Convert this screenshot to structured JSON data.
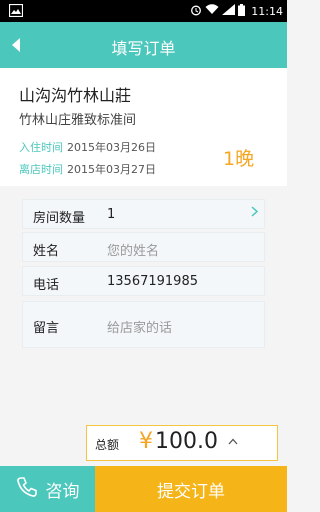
{
  "status_bar": {
    "time": "11:14"
  },
  "app_bar": {
    "title": "填写订单"
  },
  "hotel": {
    "name": "山沟沟竹林山莊",
    "room_type": "竹林山庄雅致标准间",
    "check_in_label": "入住时间",
    "check_in_date": "2015年03月26日",
    "check_out_label": "离店时间",
    "check_out_date": "2015年03月27日",
    "nights": "1晚"
  },
  "form": {
    "rooms_label": "房间数量",
    "rooms_value": "1",
    "name_label": "姓名",
    "name_placeholder": "您的姓名",
    "phone_label": "电话",
    "phone_value": "13567191985",
    "message_label": "留言",
    "message_placeholder": "给店家的话"
  },
  "total": {
    "label": "总额",
    "currency": "¥",
    "amount": "100.0"
  },
  "bottom": {
    "consult_label": "咨询",
    "submit_label": "提交订单"
  },
  "colors": {
    "accent": "#4cc7bc",
    "submit": "#f5b417",
    "price": "#f5a623"
  }
}
